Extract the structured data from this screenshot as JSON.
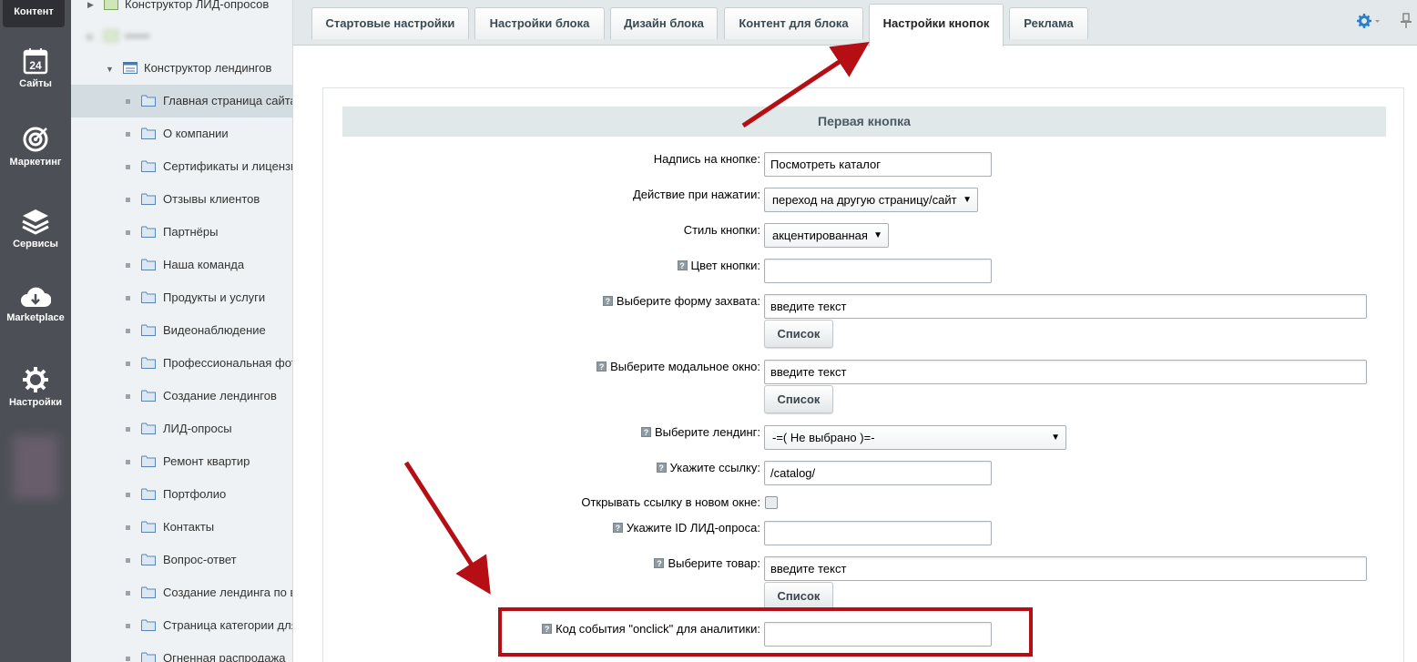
{
  "leftnav": {
    "active_label": "Контент",
    "items": [
      {
        "label": "Сайты",
        "icon": "calendar-24-icon"
      },
      {
        "label": "Маркетинг",
        "icon": "target-icon"
      },
      {
        "label": "Сервисы",
        "icon": "layers-icon"
      },
      {
        "label": "Marketplace",
        "icon": "cloud-download-icon"
      },
      {
        "label": "Настройки",
        "icon": "gear-icon"
      }
    ]
  },
  "tree": {
    "top_item": "Конструктор ЛИД-опросов",
    "blurred_item": "••••••",
    "parent": "Конструктор лендингов",
    "items": [
      "Главная страница сайта",
      "О компании",
      "Сертификаты и лицензии",
      "Отзывы клиентов",
      "Партнёры",
      "Наша команда",
      "Продукты и услуги",
      "Видеонаблюдение",
      "Профессиональная фото",
      "Создание лендингов",
      "ЛИД-опросы",
      "Ремонт квартир",
      "Портфолио",
      "Контакты",
      "Вопрос-ответ",
      "Создание лендинга по в",
      "Страница категории для",
      "Огненная распродажа"
    ]
  },
  "tabs": [
    "Стартовые настройки",
    "Настройки блока",
    "Дизайн блока",
    "Контент для блока",
    "Настройки кнопок",
    "Реклама"
  ],
  "form": {
    "section_title": "Первая кнопка",
    "help_mark": "?",
    "list_button": "Список",
    "fields": {
      "caption_label": "Надпись на кнопке:",
      "caption_value": "Посмотреть каталог",
      "action_label": "Действие при нажатии:",
      "action_value": "переход на другую страницу/сайт",
      "style_label": "Стиль кнопки:",
      "style_value": "акцентированная",
      "color_label": "Цвет кнопки:",
      "color_value": "",
      "form_label": "Выберите форму захвата:",
      "form_value": "введите текст",
      "modal_label": "Выберите модальное окно:",
      "modal_value": "введите текст",
      "landing_label": "Выберите лендинг:",
      "landing_value": "-=( Не выбрано )=-",
      "link_label": "Укажите ссылку:",
      "link_value": "/catalog/",
      "newwin_label": "Открывать ссылку в новом окне:",
      "lid_label": "Укажите ID ЛИД-опроса:",
      "lid_value": "",
      "product_label": "Выберите товар:",
      "product_value": "введите текст",
      "onclick_label": "Код события \"onclick\" для аналитики:",
      "onclick_value": ""
    }
  },
  "colors": {
    "nav_bg": "#4c4f56",
    "annotation_red": "#b50f15",
    "accent_blue": "#2a7fc9"
  }
}
